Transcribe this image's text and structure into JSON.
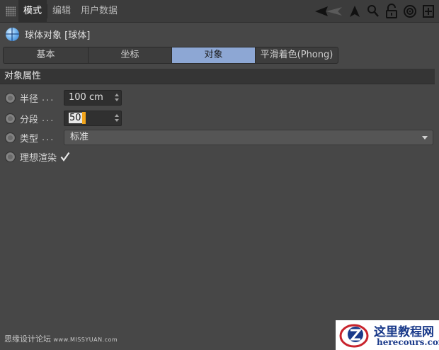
{
  "menubar": {
    "items": [
      {
        "label": "模式",
        "active": true
      },
      {
        "label": "编辑",
        "active": false
      },
      {
        "label": "用户数据",
        "active": false
      }
    ],
    "icons": [
      "back-arrow-icon",
      "cursor-arrow-icon",
      "search-icon",
      "lock-icon",
      "target-icon",
      "new-panel-icon"
    ]
  },
  "object": {
    "title": "球体对象 [球体]",
    "icon": "sphere-icon"
  },
  "tabs": [
    {
      "label": "基本",
      "active": false
    },
    {
      "label": "坐标",
      "active": false
    },
    {
      "label": "对象",
      "active": true
    },
    {
      "label": "平滑着色(Phong)",
      "active": false
    }
  ],
  "section": {
    "title": "对象属性"
  },
  "properties": {
    "radius": {
      "label": "半径",
      "dots": "...",
      "value": "100 cm"
    },
    "segments": {
      "label": "分段",
      "dots": "...",
      "value": "50"
    },
    "type": {
      "label": "类型",
      "dots": "...",
      "value": "标准"
    },
    "render_perfect": {
      "label": "理想渲染",
      "checked": true
    }
  },
  "footer": {
    "text_cn": "思缘设计论坛",
    "text_url": "www.MISSYUAN.com"
  },
  "logo": {
    "cn": "这里教程网",
    "en": "herecours.com"
  },
  "colors": {
    "active_tab": "#8da7d4",
    "caret": "#f2a51c",
    "background": "#474747"
  }
}
